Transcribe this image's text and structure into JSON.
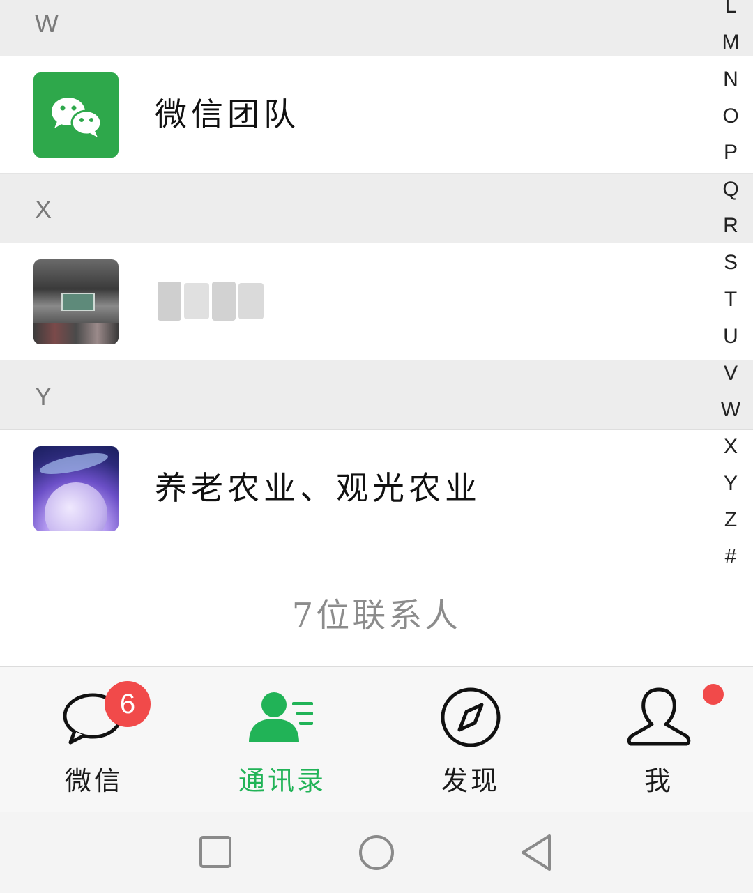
{
  "contacts": {
    "sections": [
      {
        "letter": "W",
        "items": [
          {
            "name": "微信团队",
            "avatar": "wechat-logo-avatar"
          }
        ]
      },
      {
        "letter": "X",
        "items": [
          {
            "name": "",
            "avatar": "photo-avatar",
            "name_obscured": true
          }
        ]
      },
      {
        "letter": "Y",
        "items": [
          {
            "name": "养老农业、观光农业",
            "avatar": "space-art-avatar"
          }
        ]
      }
    ],
    "count_label": "7位联系人"
  },
  "alpha_index": [
    "L",
    "M",
    "N",
    "O",
    "P",
    "Q",
    "R",
    "S",
    "T",
    "U",
    "V",
    "W",
    "X",
    "Y",
    "Z",
    "#"
  ],
  "tabs": [
    {
      "label": "微信",
      "icon": "chat-bubble-icon",
      "badge": "6",
      "active": false
    },
    {
      "label": "通讯录",
      "icon": "contacts-icon",
      "active": true
    },
    {
      "label": "发现",
      "icon": "compass-icon",
      "active": false
    },
    {
      "label": "我",
      "icon": "person-icon",
      "dot": true,
      "active": false
    }
  ],
  "system_nav": {
    "buttons": [
      "recent-apps-icon",
      "home-icon",
      "back-icon"
    ]
  },
  "colors": {
    "accent_green": "#21b357",
    "badge_red": "#f14a4a",
    "section_header_bg": "#ededed",
    "wechat_green": "#2ea84b"
  }
}
